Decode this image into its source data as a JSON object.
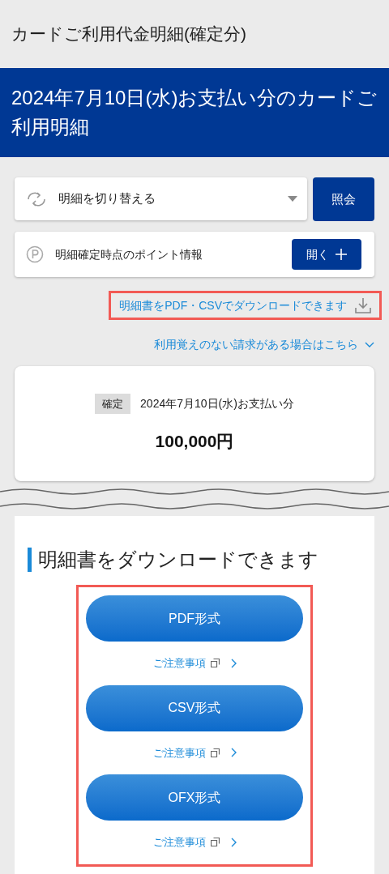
{
  "header": {
    "title": "カードご利用代金明細(確定分)"
  },
  "banner": {
    "title": "2024年7月10日(水)お支払い分のカードご利用明細"
  },
  "statement_switch": {
    "label": "明細を切り替える",
    "button": "照会"
  },
  "points": {
    "label": "明細確定時点のポイント情報",
    "button": "開く"
  },
  "links": [
    {
      "kind": "download",
      "text": "明細書をPDF・CSVでダウンロードできます",
      "highlighted": true
    },
    {
      "kind": "expand",
      "text": "利用覚えのない請求がある場合はこちら",
      "highlighted": false
    }
  ],
  "summary": {
    "badge": "確定",
    "date": "2024年7月10日(水)お支払い分",
    "amount": "100,000円"
  },
  "download": {
    "heading": "明細書をダウンロードできます",
    "highlighted": true,
    "formats": [
      {
        "label": "PDF形式",
        "note": "ご注意事項"
      },
      {
        "label": "CSV形式",
        "note": "ご注意事項"
      },
      {
        "label": "OFX形式",
        "note": "ご注意事項"
      }
    ]
  }
}
